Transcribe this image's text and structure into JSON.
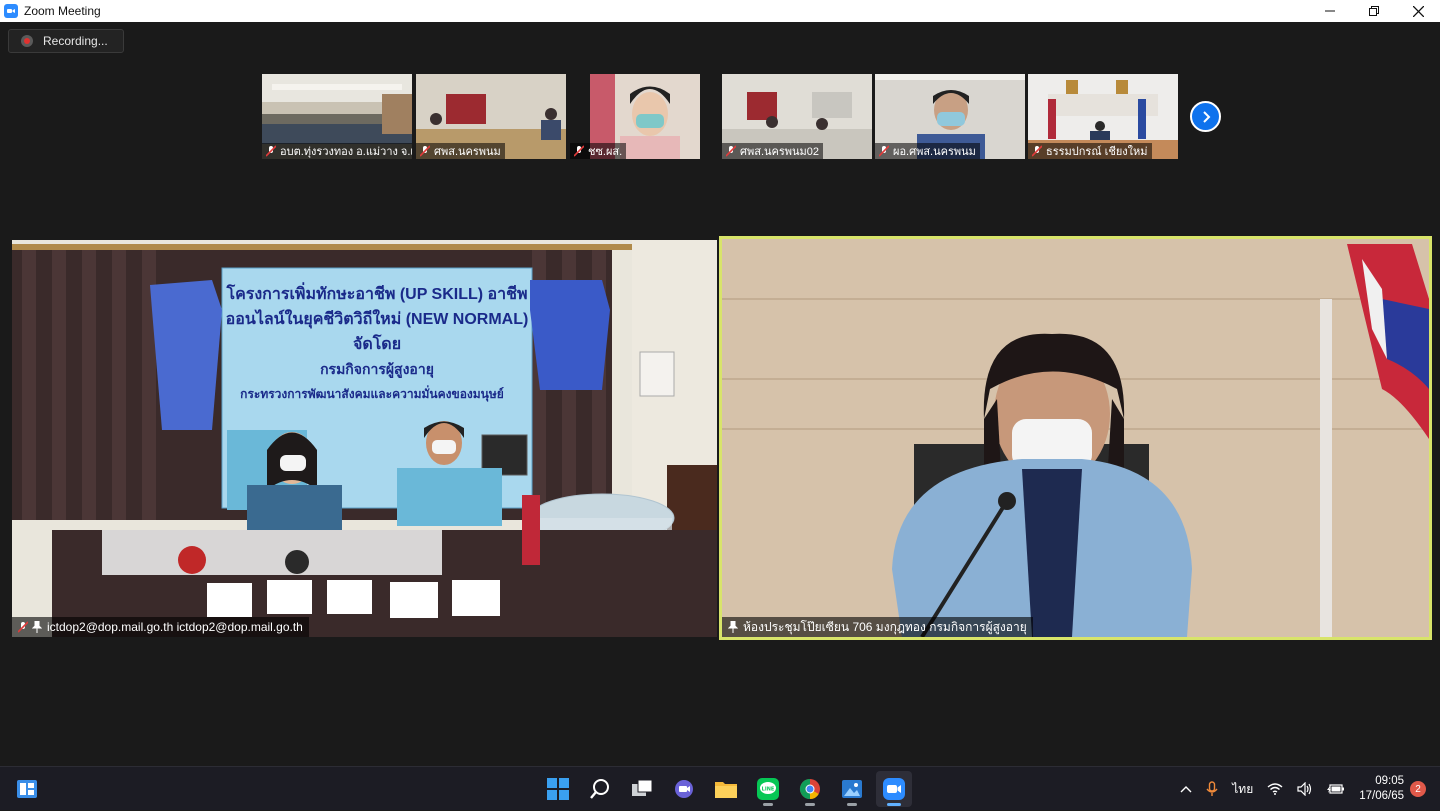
{
  "window": {
    "title": "Zoom Meeting"
  },
  "recording": {
    "label": "Recording..."
  },
  "thumbnails": [
    {
      "name": "อบต.ทุ่งรวงทอง อ.แม่วาง จ.เ..."
    },
    {
      "name": "ศพส.นครพนม"
    },
    {
      "name": "ชซ.ผส."
    },
    {
      "name": "ศพส.นครพนม02"
    },
    {
      "name": "ผอ.ศพส.นครพนม"
    },
    {
      "name": "ธรรมปกรณ์ เชียงใหม่"
    }
  ],
  "left_tile": {
    "name": "ictdop2@dop.mail.go.th ictdop2@dop.mail.go.th",
    "banner": {
      "line1": "โครงการเพิ่มทักษะอาชีพ (UP SKILL) อาชีพ",
      "line2": "ออนไลน์ในยุคชีวิตวิถีใหม่ (NEW NORMAL)",
      "line3": "จัดโดย",
      "line4": "กรมกิจการผู้สูงอายุ",
      "line5": "กระทรวงการพัฒนาสังคมและความมั่นคงของมนุษย์"
    }
  },
  "right_tile": {
    "name": "ห้องประชุมโป๊ยเซียน 706 มงกุฎทอง กรมกิจการผู้สูงอายุ"
  },
  "taskbar": {
    "language": "ไทย",
    "time": "09:05",
    "date": "17/06/65",
    "notification_count": "2"
  },
  "colors": {
    "active_speaker_border": "#d8e46a",
    "zoom_blue": "#2D8CFF",
    "background": "#1a1a1a"
  }
}
